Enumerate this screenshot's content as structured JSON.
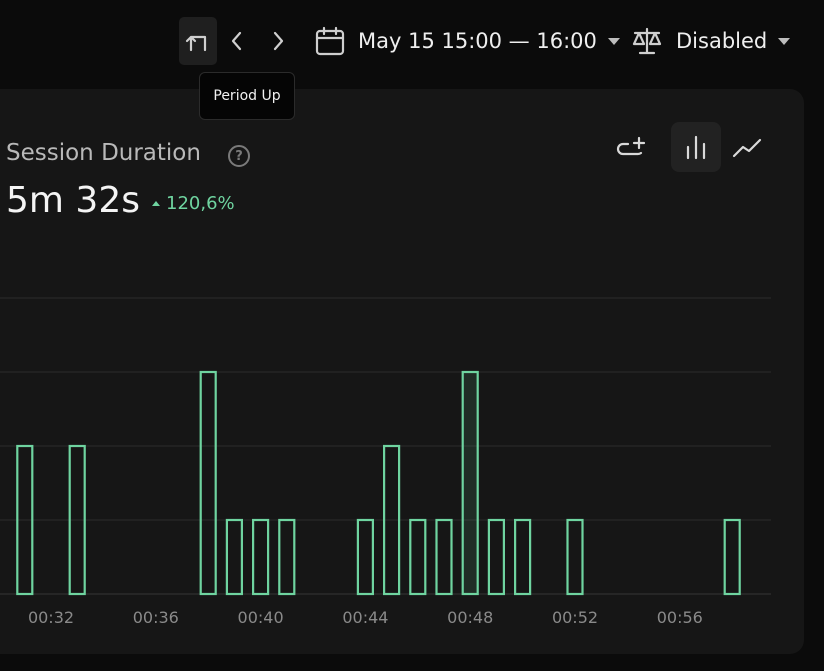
{
  "toolbar": {
    "period_up_icon": "period-up-icon",
    "prev_icon": "chevron-left-icon",
    "next_icon": "chevron-right-icon",
    "tooltip": "Period Up",
    "date_range": "May 15 15:00 — 16:00",
    "date_icon": "calendar-icon",
    "compare": "Disabled",
    "compare_icon": "scale-icon"
  },
  "card": {
    "title": "Session Duration",
    "help_icon": "?",
    "value": "5m 32s",
    "delta": "120,6%",
    "delta_color": "#6fd4a0",
    "tools": [
      "add-to-dashboard-icon",
      "bar-chart-icon",
      "line-chart-icon"
    ],
    "active_tool": "bar-chart-icon"
  },
  "chart_data": {
    "type": "bar",
    "x_tick_labels": [
      "00:32",
      "00:36",
      "00:40",
      "00:44",
      "00:48",
      "00:52",
      "00:56"
    ],
    "x": [
      "00:31",
      "00:33",
      "00:38",
      "00:39",
      "00:40",
      "00:41",
      "00:44",
      "00:45",
      "00:46",
      "00:47",
      "00:48",
      "00:49",
      "00:50",
      "00:52",
      "00:58"
    ],
    "values": [
      2,
      2,
      3,
      1,
      1,
      1,
      1,
      2,
      1,
      1,
      3,
      1,
      1,
      1,
      1
    ],
    "ylim": [
      0,
      4
    ],
    "grid": true,
    "bar_color": "#6fd4a0"
  }
}
